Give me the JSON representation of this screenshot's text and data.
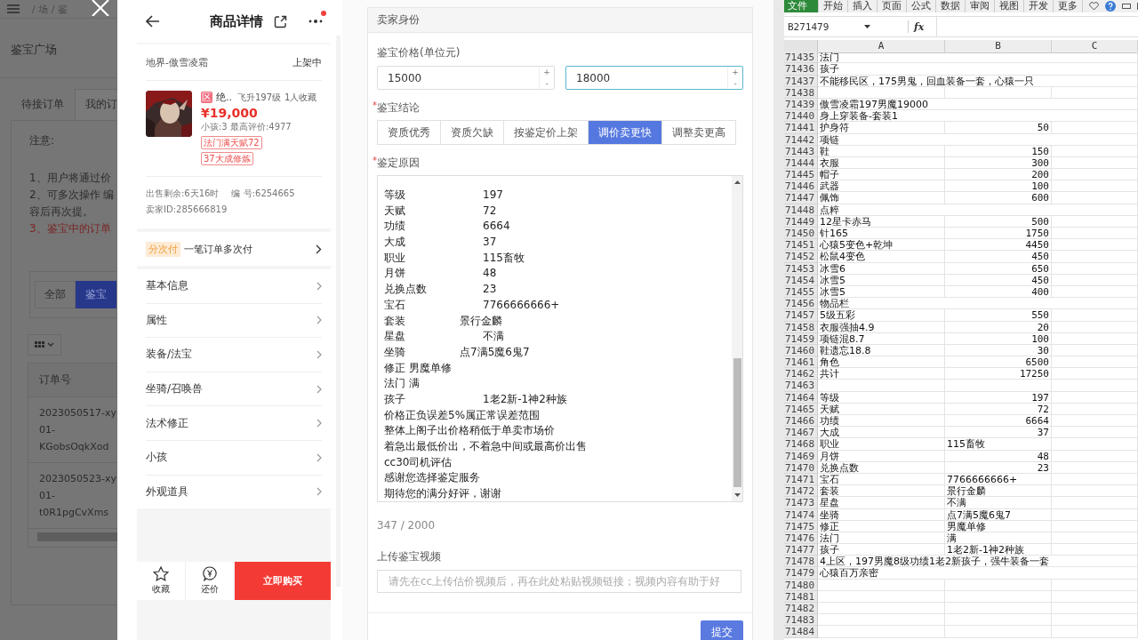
{
  "background_page": {
    "breadcrumb": "/ 场 / 鉴",
    "title": "鉴宝广场",
    "tabs": [
      {
        "label": "待接订单",
        "selected": false
      },
      {
        "label": "我的订",
        "selected": true
      }
    ],
    "notice_title": "注意:",
    "notice_lines": [
      {
        "text": "1、用户将通过价",
        "kind": "normal"
      },
      {
        "text": "2、可多次操作 编",
        "kind": "normal"
      },
      {
        "text": "容后再次提。",
        "kind": "normal"
      },
      {
        "text": "3、鉴宝中的订单",
        "kind": "warning"
      }
    ],
    "filters": [
      {
        "label": "全部",
        "selected": false
      },
      {
        "label": "鉴宝",
        "selected": true
      }
    ],
    "table": {
      "columns": [
        "订单号"
      ],
      "rows": [
        {
          "order_no_lines": [
            "2023050517-xy",
            "01-",
            "KGobsOqkXod"
          ]
        },
        {
          "order_no_lines": [
            "2023050523-xy",
            "01-",
            "t0R1pgCvXms"
          ]
        }
      ]
    }
  },
  "product_detail": {
    "title": "商品详情",
    "has_notification": true,
    "server": "地界-傲雪凌霜",
    "status": "上架中",
    "zone_badge": "区",
    "name": "绝..",
    "level_info": "飞升197级",
    "favorites": "1人收藏",
    "price": "¥19,000",
    "stats": "小孩:3 最高评价:4977",
    "tags": [
      "法门满天赋72",
      "37大成修炼"
    ],
    "time_left": "出售剩余:6天16时",
    "serial": "编 号:6254665",
    "seller_id": "卖家ID:285666819",
    "installment_tag": "分次付",
    "installment_text": "一笔订单多次付",
    "sections": [
      "基本信息",
      "属性",
      "装备/法宝",
      "坐骑/召唤兽",
      "法术修正",
      "小孩",
      "外观道具"
    ],
    "actions": [
      {
        "label": "收藏",
        "kind": "favorite"
      },
      {
        "label": "还价",
        "kind": "bargain"
      }
    ],
    "buy_button": "立即购买"
  },
  "appraisal_form": {
    "header": "卖家身份",
    "price_label": "鉴宝价格(单位元)",
    "prices": [
      {
        "value": "15000",
        "focused": false,
        "increment": "+",
        "decrement": "-"
      },
      {
        "value": "18000",
        "focused": true,
        "increment": "+",
        "decrement": "-"
      }
    ],
    "conclusion_label": {
      "mark": "*",
      "text": "鉴宝结论"
    },
    "conclusions": [
      {
        "label": "资质优秀",
        "selected": false
      },
      {
        "label": "资质欠缺",
        "selected": false
      },
      {
        "label": "按鉴定价上架",
        "selected": false
      },
      {
        "label": "调价卖更快",
        "selected": true
      },
      {
        "label": "调整卖更高",
        "selected": false
      }
    ],
    "reason_label": {
      "mark": "*",
      "text": "鉴定原因"
    },
    "reason_lines": [
      {
        "label": "等级",
        "value": "197",
        "kind": "far"
      },
      {
        "label": "天赋",
        "value": "72",
        "kind": "far"
      },
      {
        "label": "功绩",
        "value": "6664",
        "kind": "far"
      },
      {
        "label": "大成",
        "value": "37",
        "kind": "far"
      },
      {
        "label": "职业",
        "value": "115畜牧",
        "kind": "far"
      },
      {
        "label": "月饼",
        "value": "48",
        "kind": "far"
      },
      {
        "label": "兑换点数",
        "value": "23",
        "kind": "far"
      },
      {
        "label": "宝石",
        "value": "7766666666+",
        "kind": "far"
      },
      {
        "label": "套装",
        "value": "景行金麟",
        "kind": "near"
      },
      {
        "label": "星盘",
        "value": "不满",
        "kind": "far"
      },
      {
        "label": "坐骑",
        "value": "点7满5魔6鬼7",
        "kind": "near"
      },
      {
        "label": "修正 男魔单修",
        "kind": "plain"
      },
      {
        "label": "法门 满",
        "kind": "plain"
      },
      {
        "label": "孩子",
        "value": "1老2新-1神2种族",
        "kind": "far"
      },
      {
        "label": "价格正负误差5%属正常误差范围",
        "kind": "plain"
      },
      {
        "label": "整体上阁子出价格稍低于单卖市场价",
        "kind": "plain"
      },
      {
        "label": "着急出最低价出，不着急中间或最高价出售",
        "kind": "plain"
      },
      {
        "label": "cc30司机评估",
        "kind": "plain"
      },
      {
        "label": "感谢您选择鉴定服务",
        "kind": "plain"
      },
      {
        "label": "期待您的满分好评，谢谢",
        "kind": "plain"
      }
    ],
    "char_count": "347 / 2000",
    "video_label": "上传鉴宝视频",
    "video_placeholder": "请先在cc上传估价视频后，再在此处粘贴视频链接；视频内容有助于好",
    "submit": "提交"
  },
  "spreadsheet": {
    "ribbon_tabs": [
      {
        "label": "文件",
        "selected": true
      },
      {
        "label": "开始",
        "selected": false
      },
      {
        "label": "插入",
        "selected": false
      },
      {
        "label": "页面",
        "selected": false
      },
      {
        "label": "公式",
        "selected": false
      },
      {
        "label": "数据",
        "selected": false
      },
      {
        "label": "审阅",
        "selected": false
      },
      {
        "label": "视图",
        "selected": false
      },
      {
        "label": "开发",
        "selected": false
      },
      {
        "label": "更多",
        "selected": false
      }
    ],
    "name_box": "B271479",
    "formula_icon": "fx",
    "columns": [
      "A",
      "B",
      "C"
    ],
    "rows": [
      {
        "row": "71435",
        "a": "法门"
      },
      {
        "row": "71436",
        "a": "孩子"
      },
      {
        "row": "71437",
        "a": "不能移民区，175男鬼，回血装备一套，心猿一只"
      },
      {
        "row": "71438"
      },
      {
        "row": "71439",
        "a": "傲雪凌霜197男魔19000"
      },
      {
        "row": "71440",
        "a": "身上穿装备-套装1"
      },
      {
        "row": "71441",
        "a": "护身符",
        "b": "50",
        "b_numeric": true
      },
      {
        "row": "71442",
        "a": "项链"
      },
      {
        "row": "71443",
        "a": "鞋",
        "b": "150",
        "b_numeric": true
      },
      {
        "row": "71444",
        "a": "衣服",
        "b": "300",
        "b_numeric": true
      },
      {
        "row": "71445",
        "a": "帽子",
        "b": "200",
        "b_numeric": true
      },
      {
        "row": "71446",
        "a": "武器",
        "b": "100",
        "b_numeric": true
      },
      {
        "row": "71447",
        "a": "佩饰",
        "b": "600",
        "b_numeric": true
      },
      {
        "row": "71448",
        "a": "点粹"
      },
      {
        "row": "71449",
        "a": "12星卡赤马",
        "b": "500",
        "b_numeric": true
      },
      {
        "row": "71450",
        "a": "针165",
        "b": "1750",
        "b_numeric": true
      },
      {
        "row": "71451",
        "a": "心猿5变色+乾坤",
        "b": "4450",
        "b_numeric": true
      },
      {
        "row": "71452",
        "a": "松鼠4变色",
        "b": "450",
        "b_numeric": true
      },
      {
        "row": "71453",
        "a": "冰雪6",
        "b": "650",
        "b_numeric": true
      },
      {
        "row": "71454",
        "a": "冰雪5",
        "b": "450",
        "b_numeric": true
      },
      {
        "row": "71455",
        "a": "冰雪5",
        "b": "400",
        "b_numeric": true
      },
      {
        "row": "71456",
        "a": "物品栏"
      },
      {
        "row": "71457",
        "a": "5级五彩",
        "b": "550",
        "b_numeric": true
      },
      {
        "row": "71458",
        "a": "衣服强抽4.9",
        "b": "20",
        "b_numeric": true
      },
      {
        "row": "71459",
        "a": "项链混8.7",
        "b": "100",
        "b_numeric": true
      },
      {
        "row": "71460",
        "a": "鞋遗忘18.8",
        "b": "30",
        "b_numeric": true
      },
      {
        "row": "71461",
        "a": "角色",
        "b": "6500",
        "b_numeric": true
      },
      {
        "row": "71462",
        "a": "共计",
        "b": "17250",
        "b_numeric": true
      },
      {
        "row": "71463"
      },
      {
        "row": "71464",
        "a": "等级",
        "b": "197",
        "b_numeric": true
      },
      {
        "row": "71465",
        "a": "天赋",
        "b": "72",
        "b_numeric": true
      },
      {
        "row": "71466",
        "a": "功绩",
        "b": "6664",
        "b_numeric": true
      },
      {
        "row": "71467",
        "a": "大成",
        "b": "37",
        "b_numeric": true
      },
      {
        "row": "71468",
        "a": "职业",
        "b": "115畜牧",
        "b_numeric": false
      },
      {
        "row": "71469",
        "a": "月饼",
        "b": "48",
        "b_numeric": true
      },
      {
        "row": "71470",
        "a": "兑换点数",
        "b": "23",
        "b_numeric": true
      },
      {
        "row": "71471",
        "a": "宝石",
        "b": "7766666666+",
        "b_numeric": false
      },
      {
        "row": "71472",
        "a": "套装",
        "b": "景行金麟",
        "b_numeric": false
      },
      {
        "row": "71473",
        "a": "星盘",
        "b": "不满",
        "b_numeric": false
      },
      {
        "row": "71474",
        "a": "坐骑",
        "b": "点7满5魔6鬼7",
        "b_numeric": false
      },
      {
        "row": "71475",
        "a": "修正",
        "b": "男魔单修",
        "b_numeric": false
      },
      {
        "row": "71476",
        "a": "法门",
        "b": "满",
        "b_numeric": false
      },
      {
        "row": "71477",
        "a": "孩子",
        "b": "1老2新-1神2种族",
        "b_numeric": false
      },
      {
        "row": "71478",
        "a": "4上区，197男魔8级功绩1老2新孩子，强牛装备一套"
      },
      {
        "row": "71479",
        "a": "心猿百万亲密"
      },
      {
        "row": "71480"
      },
      {
        "row": "71481"
      },
      {
        "row": "71482"
      },
      {
        "row": "71483"
      },
      {
        "row": "71484"
      }
    ]
  }
}
